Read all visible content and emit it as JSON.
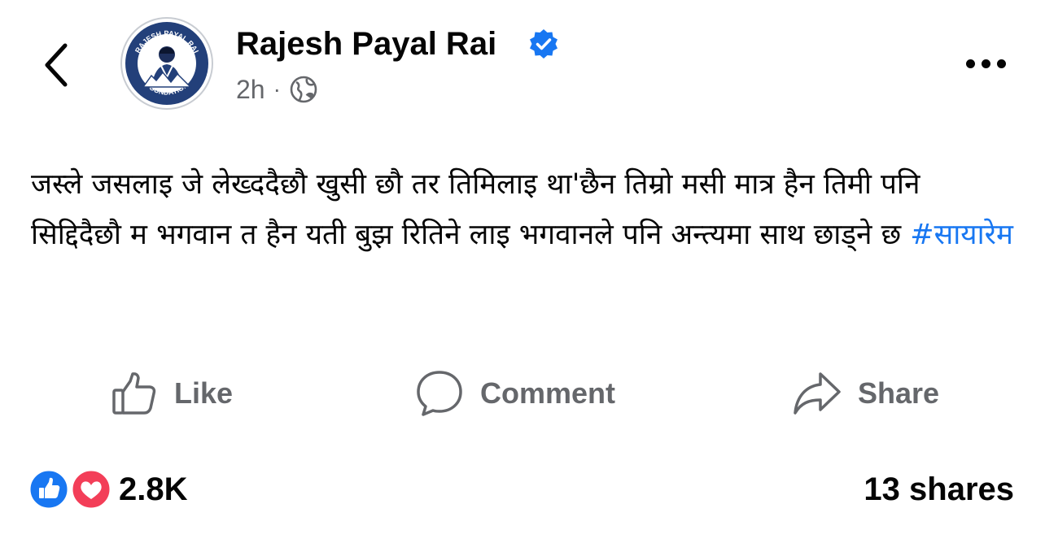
{
  "header": {
    "back_icon": "chevron-left-icon",
    "author_name": "Rajesh Payal Rai",
    "verified_icon": "verified-badge-icon",
    "time_ago": "2h",
    "separator": "·",
    "audience_icon": "globe-icon",
    "more_icon": "more-horizontal-icon",
    "avatar": {
      "logo_text_top": "RAJESH PAYAL RAI",
      "logo_text_bottom": "FOUNDATION"
    }
  },
  "post": {
    "text": "जस्ले जसलाइ जे लेख्ददैछौ खुसी छौ तर तिमिलाइ था'छैन तिम्रो मसी मात्र हैन तिमी पनि सिद्दिदैछौ म भगवान त हैन यती बुझ रितिने लाइ भगवानले पनि अन्त्यमा साथ छाड्ने छ ",
    "hashtag": "#सायारेम"
  },
  "actions": {
    "like": {
      "label": "Like",
      "icon": "thumbs-up-icon"
    },
    "comment": {
      "label": "Comment",
      "icon": "speech-bubble-icon"
    },
    "share": {
      "label": "Share",
      "icon": "share-arrow-icon"
    }
  },
  "footer": {
    "reaction_icons": [
      "like-reaction-icon",
      "love-reaction-icon"
    ],
    "reaction_count": "2.8K",
    "shares": "13 shares"
  },
  "colors": {
    "brand_blue": "#1877f2",
    "love_red": "#f33e58",
    "secondary_text": "#65676b",
    "primary_text": "#050505"
  }
}
